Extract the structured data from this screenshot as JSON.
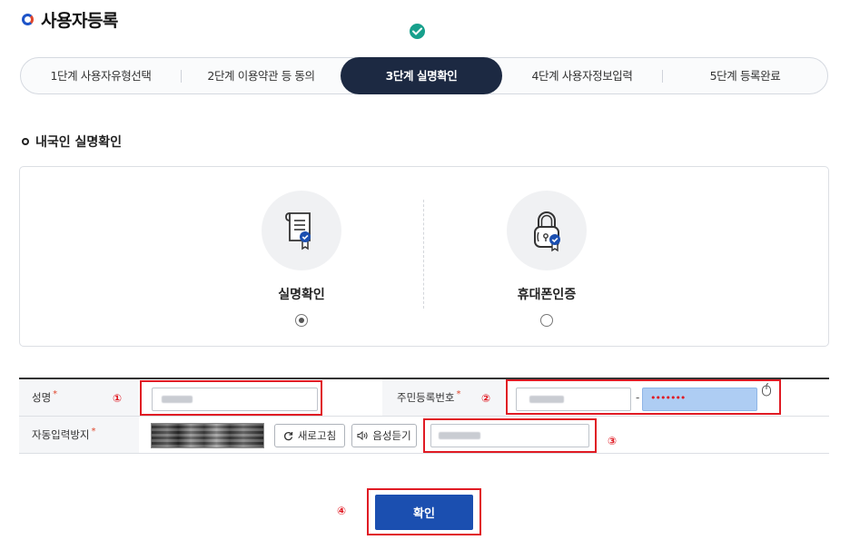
{
  "page": {
    "title": "사용자등록"
  },
  "steps": [
    {
      "label": "1단계 사용자유형선택"
    },
    {
      "label": "2단계 이용약관 등 동의"
    },
    {
      "label": "3단계 실명확인"
    },
    {
      "label": "4단계 사용자정보입력"
    },
    {
      "label": "5단계 등록완료"
    }
  ],
  "active_step": 3,
  "section": {
    "title": "내국인 실명확인"
  },
  "methods": [
    {
      "label": "실명확인",
      "icon": "certificate-icon",
      "selected": true
    },
    {
      "label": "휴대폰인증",
      "icon": "lock-icon",
      "selected": false
    }
  ],
  "form": {
    "name_label": "성명",
    "rrn_label": "주민등록번호",
    "rrn_separator": "-",
    "rrn_back_value": "•••••••",
    "captcha_label": "자동입력방지",
    "refresh_label": "새로고침",
    "audio_label": "음성듣기",
    "required_mark": "*"
  },
  "annotations": {
    "n1": "①",
    "n2": "②",
    "n3": "③",
    "n4": "④"
  },
  "confirm_label": "확인",
  "colors": {
    "accent": "#1b4fb0",
    "active_step_bg": "#1c2942",
    "check": "#17a08c",
    "highlight": "#e01b24",
    "masked_field": "#aecdf3"
  }
}
